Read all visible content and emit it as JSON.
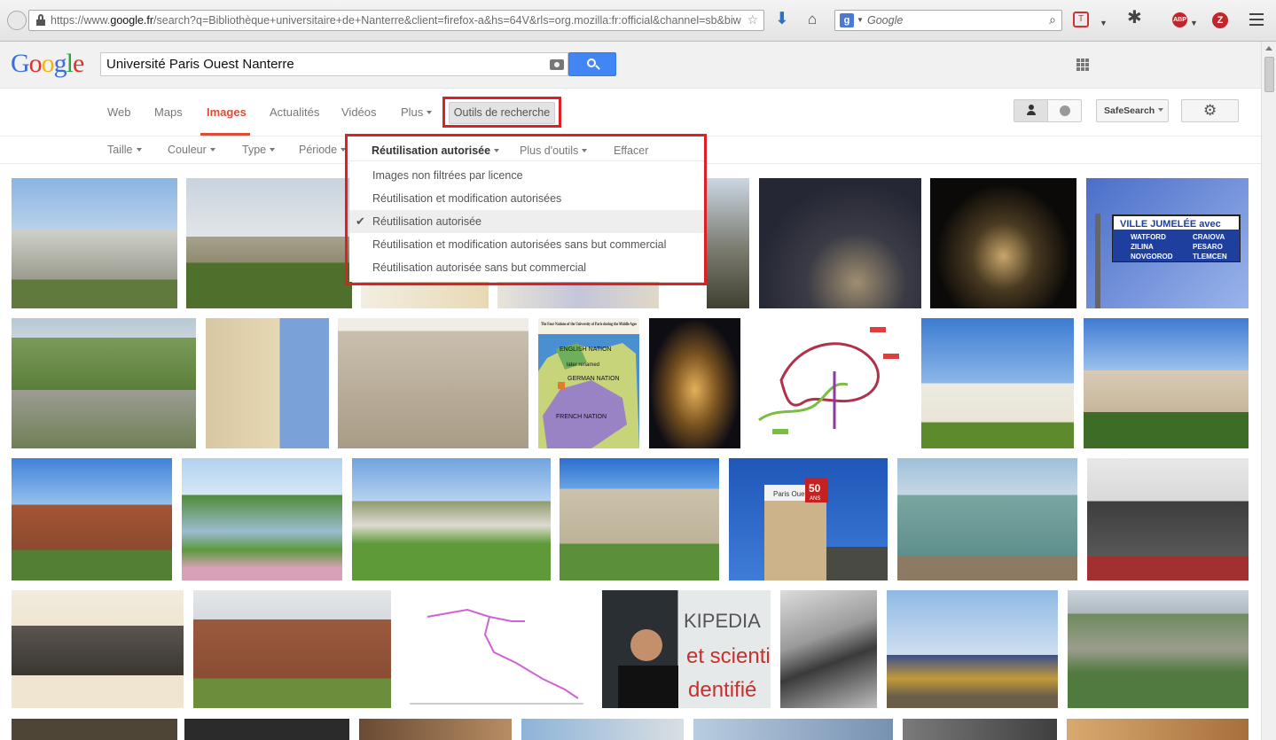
{
  "browser": {
    "url_prefix": "https://www.",
    "url_domain": "google.fr",
    "url_rest": "/search?q=Bibliothèque+universitaire+de+Nanterre&client=firefox-a&hs=64V&rls=org.mozilla:fr:official&channel=sb&biw",
    "search_placeholder": "Google",
    "abp_label": "ABP",
    "z_label": "Z"
  },
  "google": {
    "logo_letters": [
      "G",
      "o",
      "o",
      "g",
      "l",
      "e"
    ],
    "query": "Université Paris Ouest Nanterre"
  },
  "nav": {
    "web": "Web",
    "maps": "Maps",
    "images": "Images",
    "news": "Actualités",
    "videos": "Vidéos",
    "more": "Plus",
    "search_tools": "Outils de recherche",
    "safesearch": "SafeSearch"
  },
  "tools": {
    "size": "Taille",
    "color": "Couleur",
    "type": "Type",
    "period": "Période"
  },
  "license_menu": {
    "current": "Réutilisation autorisée",
    "more_tools": "Plus d'outils",
    "clear": "Effacer",
    "options": [
      {
        "label": "Images non filtrées par licence",
        "selected": false
      },
      {
        "label": "Réutilisation et modification autorisées",
        "selected": false
      },
      {
        "label": "Réutilisation autorisée",
        "selected": true
      },
      {
        "label": "Réutilisation et modification autorisées sans but commercial",
        "selected": false
      },
      {
        "label": "Réutilisation autorisée sans but commercial",
        "selected": false
      }
    ]
  },
  "image_results": {
    "map_texts": {
      "title": "The Four Nations of the University of Paris during the Middle Ages",
      "english": "ENGLISH NATION",
      "later": "later renamed",
      "german": "GERMAN NATION",
      "french": "FRENCH NATION"
    },
    "sign_texts": {
      "heading": "VILLE JUMELÉE avec",
      "cities": [
        "WATFORD",
        "CRAIOVA",
        "ZILINA",
        "PESARO",
        "NOVGOROD",
        "TLEMCEN"
      ]
    },
    "wiki_text": [
      "KIPEDIA",
      "et scientif",
      "dentifié"
    ],
    "building_sign": {
      "name": "Paris Ouest",
      "years": "50",
      "suffix": "ANS"
    }
  }
}
